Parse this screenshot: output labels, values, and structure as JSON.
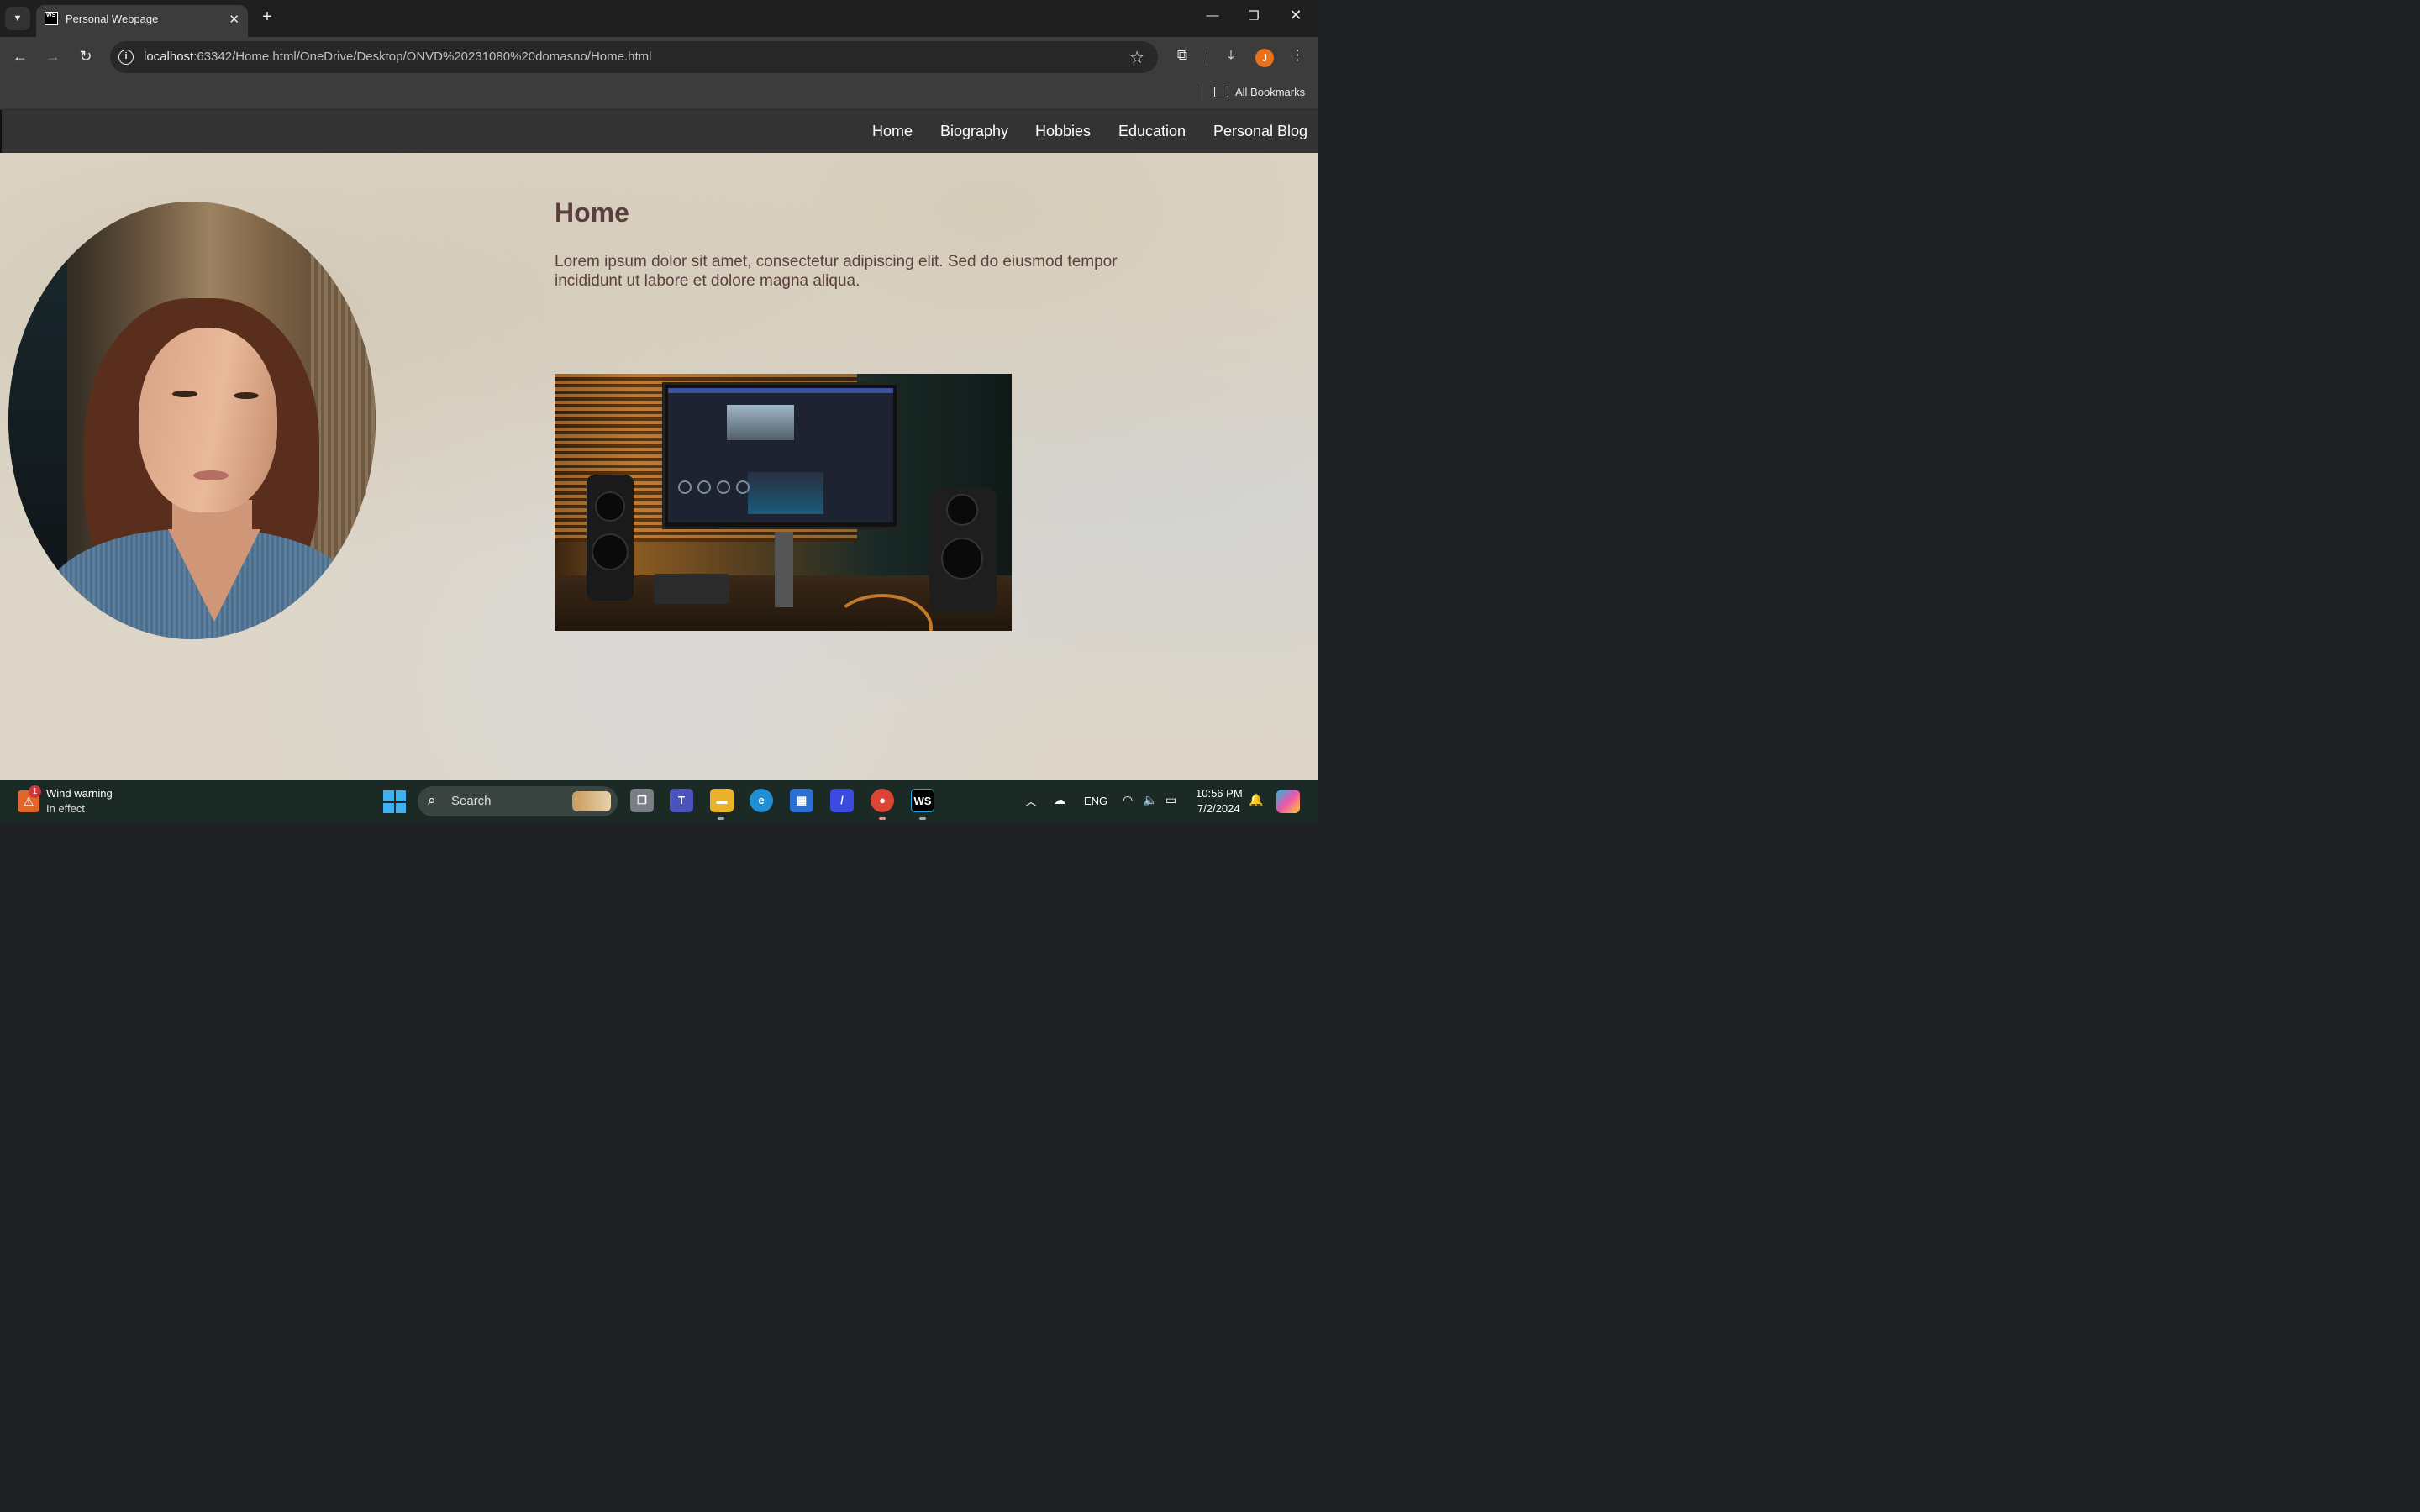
{
  "browser": {
    "tab_title": "Personal Webpage",
    "tab_favicon_text": "WS",
    "url_host": "localhost",
    "url_rest": ":63342/Home.html/OneDrive/Desktop/ONVD%20231080%20domasno/Home.html",
    "profile_initial": "J",
    "bookmarks_label": "All Bookmarks"
  },
  "site": {
    "nav": [
      "Home",
      "Biography",
      "Hobbies",
      "Education",
      "Personal Blog"
    ],
    "title": "Home",
    "body": "Lorem ipsum dolor sit amet, consectetur adipiscing elit. Sed do eiusmod tempor incididunt ut labore et dolore magna aliqua."
  },
  "taskbar": {
    "weather_title": "Wind warning",
    "weather_sub": "In effect",
    "weather_badge": "1",
    "search_placeholder": "Search",
    "tray_lang": "ENG",
    "time": "10:56 PM",
    "date": "7/2/2024"
  },
  "icons": {
    "back": "arrow-left-icon",
    "forward": "arrow-right-icon",
    "reload": "reload-icon",
    "star": "star-icon",
    "extensions": "puzzle-icon",
    "download": "download-icon",
    "menu": "kebab-menu-icon"
  }
}
